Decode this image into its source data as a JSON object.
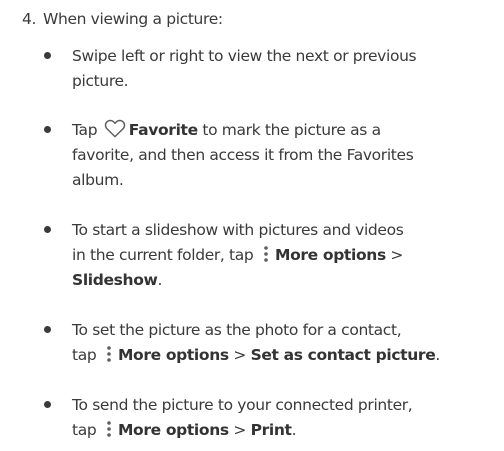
{
  "step": {
    "number": "4.",
    "intro": "When viewing a picture:"
  },
  "bullets": [
    {
      "lines": [
        "Swipe left or right to view the next or previous",
        "picture."
      ]
    },
    {
      "tap": "Tap",
      "favorite_label": "Favorite",
      "rest_line1": "to mark the picture as a",
      "rest_line2": "favorite, and then access it from the Favorites",
      "rest_line3": "album."
    },
    {
      "line1": "To start a slideshow with pictures and videos",
      "line2_pre": "in the current folder, tap",
      "more_label": "More options",
      "separator": ">",
      "target": "Slideshow",
      "end": "."
    },
    {
      "line1": "To set the picture as the photo for a contact,",
      "line2_pre": "tap",
      "more_label": "More options",
      "separator": ">",
      "target": "Set as contact picture",
      "end": "."
    },
    {
      "line1": "To send the picture to your connected printer,",
      "line2_pre": "tap",
      "more_label": "More options",
      "separator": ">",
      "target": "Print",
      "end": "."
    }
  ],
  "icons": {
    "favorite": "heart-outline-icon",
    "more_options": "more-options-vertical-dots-icon"
  },
  "colors": {
    "text": "#3a3a3a",
    "icon": "#5f5f5f"
  }
}
